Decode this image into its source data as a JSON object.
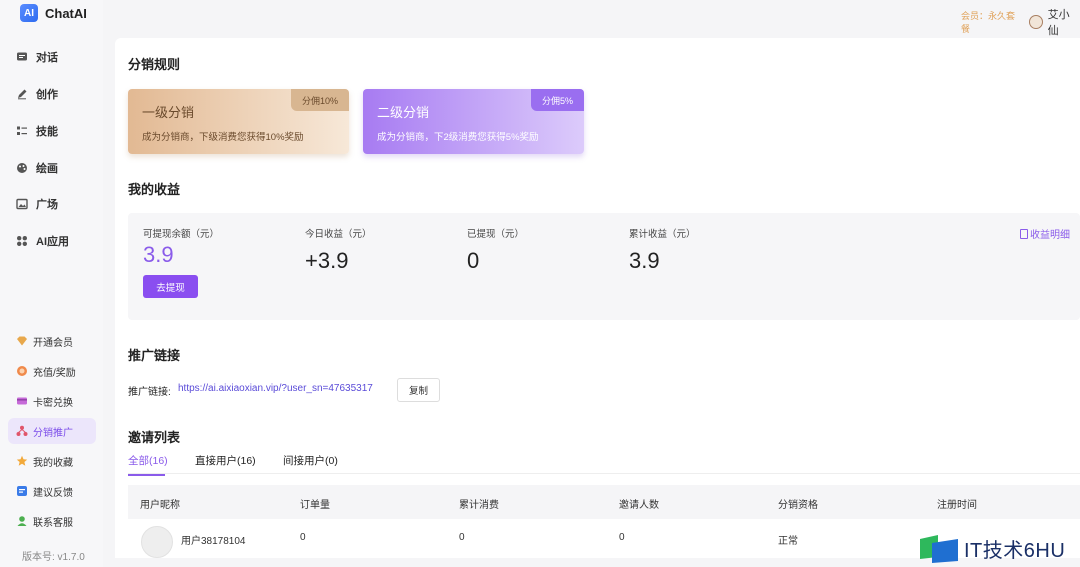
{
  "app": {
    "logo_text": "AI",
    "name": "ChatAI"
  },
  "nav_primary": [
    {
      "label": "对话",
      "icon": "chat-icon"
    },
    {
      "label": "创作",
      "icon": "pen-icon"
    },
    {
      "label": "技能",
      "icon": "list-icon"
    },
    {
      "label": "绘画",
      "icon": "palette-icon"
    },
    {
      "label": "广场",
      "icon": "image-icon"
    },
    {
      "label": "AI应用",
      "icon": "grid-icon"
    }
  ],
  "nav_secondary": [
    {
      "label": "开通会员",
      "icon": "diamond-icon"
    },
    {
      "label": "充值/奖励",
      "icon": "coin-icon"
    },
    {
      "label": "卡密兑换",
      "icon": "card-icon"
    },
    {
      "label": "分销推广",
      "icon": "share-icon",
      "active": true
    },
    {
      "label": "我的收藏",
      "icon": "star-icon"
    },
    {
      "label": "建议反馈",
      "icon": "feedback-icon"
    },
    {
      "label": "联系客服",
      "icon": "service-icon"
    }
  ],
  "version": "版本号: v1.7.0",
  "topbar": {
    "member": "会员：永久套餐",
    "username": "艾小仙"
  },
  "rules": {
    "title": "分销规则",
    "level1": {
      "title": "一级分销",
      "desc": "成为分销商，下级消费您获得10%奖励",
      "tag": "分佣10%"
    },
    "level2": {
      "title": "二级分销",
      "desc": "成为分销商，下2级消费您获得5%奖励",
      "tag": "分佣5%"
    }
  },
  "earnings": {
    "title": "我的收益",
    "available_label": "可提现余额（元）",
    "available_value": "3.9",
    "today_label": "今日收益（元）",
    "today_value": "+3.9",
    "withdrawn_label": "已提现（元）",
    "withdrawn_value": "0",
    "total_label": "累计收益（元）",
    "total_value": "3.9",
    "withdraw_button": "去提现",
    "detail_link": "收益明细"
  },
  "promo": {
    "title": "推广链接",
    "label": "推广链接:",
    "url": "https://ai.aixiaoxian.vip/?user_sn=47635317",
    "copy_button": "复制"
  },
  "invites": {
    "title": "邀请列表",
    "tabs": [
      "全部(16)",
      "直接用户(16)",
      "间接用户(0)"
    ],
    "columns": [
      "用户昵称",
      "订单量",
      "累计消费",
      "邀请人数",
      "分销资格",
      "注册时间"
    ],
    "rows": [
      {
        "nickname": "用户38178104",
        "orders": "0",
        "spend": "0",
        "invited": "0",
        "qualification": "正常"
      }
    ]
  },
  "watermark": "IT技术6HU"
}
